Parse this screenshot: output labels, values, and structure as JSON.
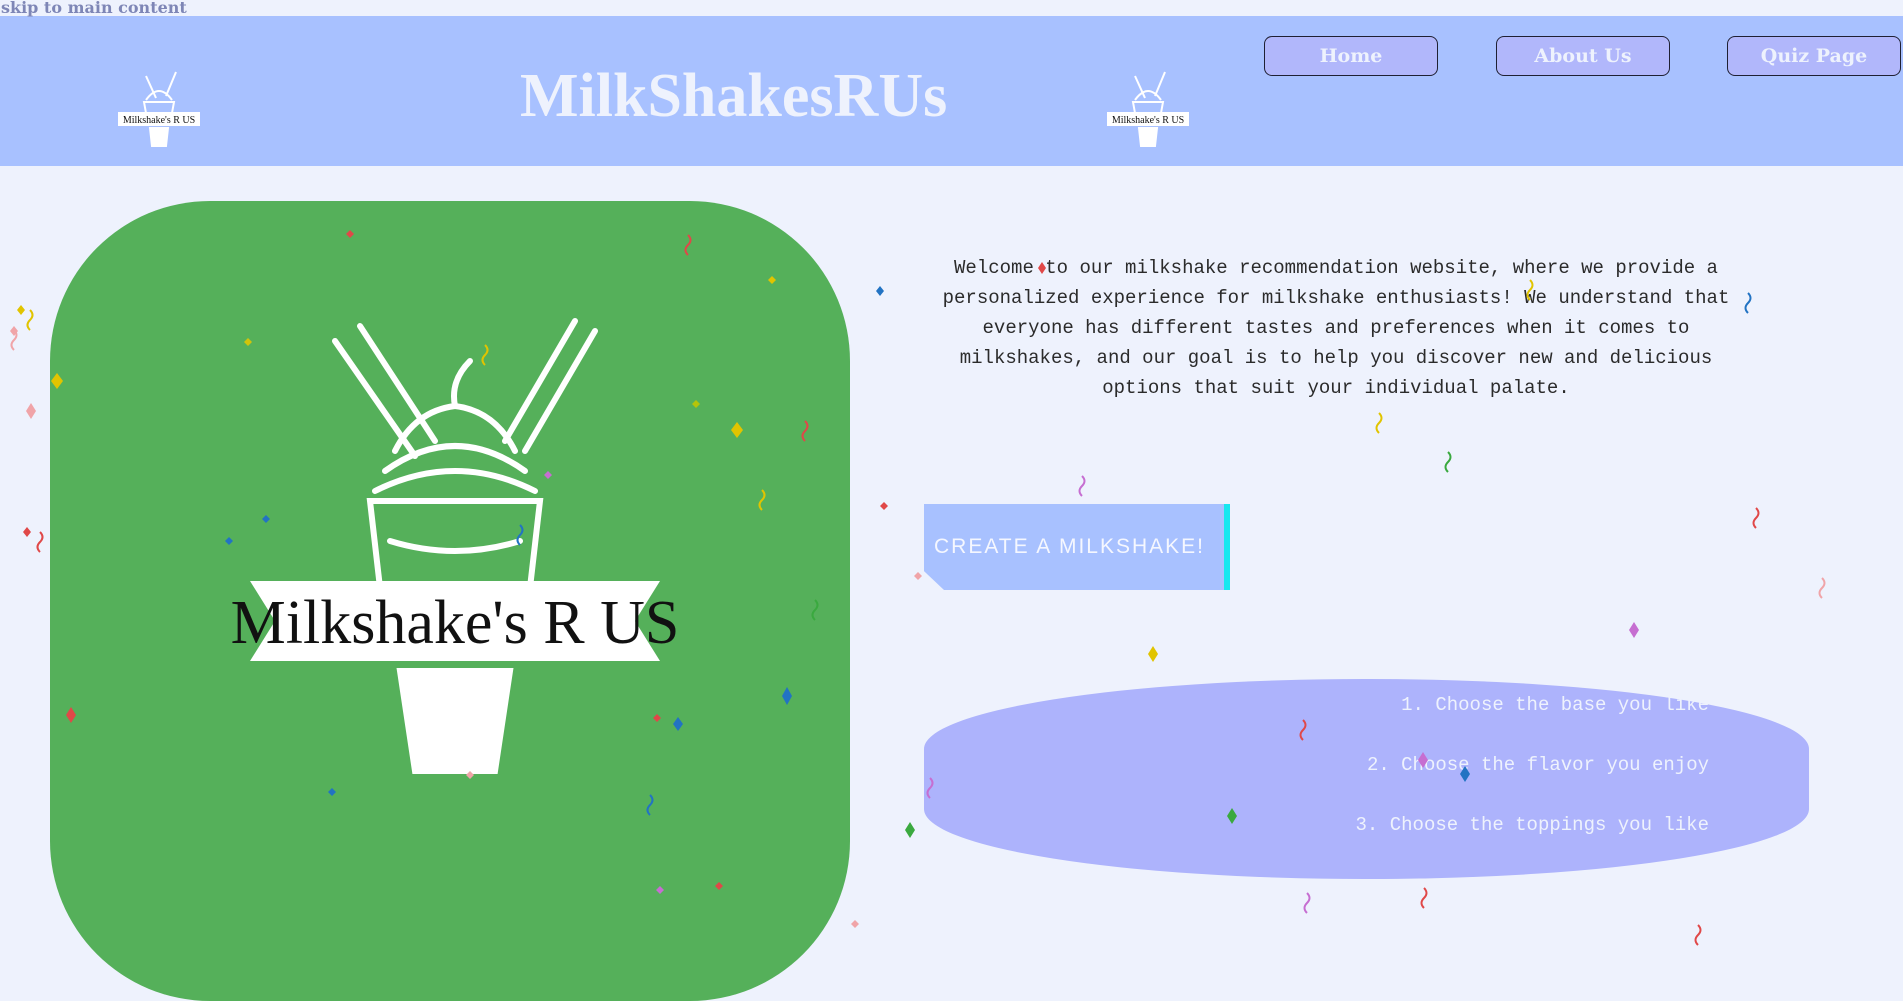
{
  "skip_link": "skip to main content",
  "header": {
    "title": "MilkShakesRUs",
    "logo_text": "Milkshake's R US",
    "nav": [
      {
        "label": "Home"
      },
      {
        "label": "About Us"
      },
      {
        "label": "Quiz Page"
      }
    ]
  },
  "hero": {
    "logo_text": "Milkshake's R US"
  },
  "main": {
    "welcome": "Welcome to our milkshake recommendation website, where we provide a personalized experience for milkshake enthusiasts! We understand that everyone has different tastes and preferences when it comes to milkshakes, and our goal is to help you discover new and delicious options that suit your individual palate.",
    "cta_label": "CREATE A MILKSHAKE!",
    "steps": [
      "1. Choose the base you like",
      "2. Choose the flavor you enjoy",
      "3. Choose the toppings you like"
    ]
  },
  "colors": {
    "header_bg": "#a8c1ff",
    "page_bg": "#eef2fd",
    "hero_green": "#55b05a",
    "nav_button": "#b1b7fb",
    "steps_bg": "#adb3fc",
    "cta_accent": "#17e7ef"
  }
}
